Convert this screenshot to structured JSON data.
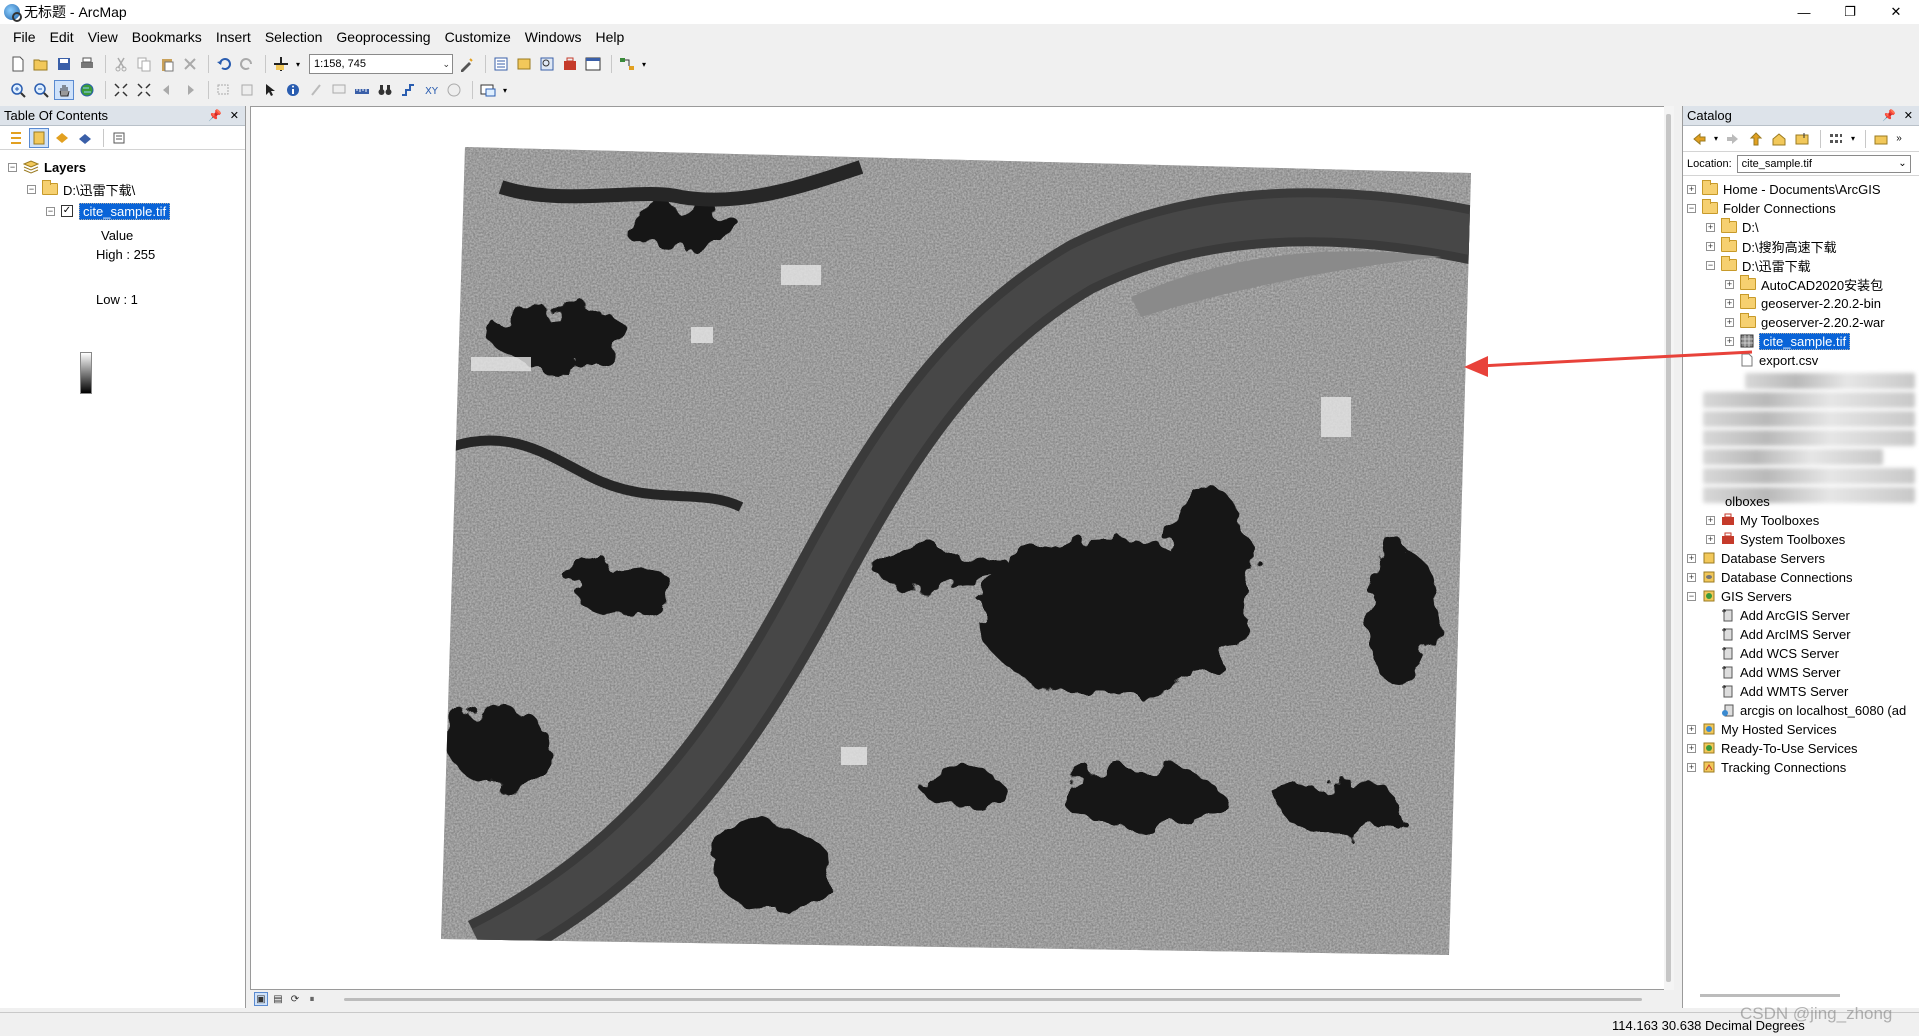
{
  "window": {
    "title": "无标题 - ArcMap",
    "minimize": "—",
    "maximize": "❐",
    "close": "✕"
  },
  "menu": [
    "File",
    "Edit",
    "View",
    "Bookmarks",
    "Insert",
    "Selection",
    "Geoprocessing",
    "Customize",
    "Windows",
    "Help"
  ],
  "toolbar": {
    "scale_value": "1:158, 745"
  },
  "toc": {
    "title": "Table Of Contents",
    "layers_label": "Layers",
    "folder_label": "D:\\迅雷下载\\",
    "layer_label": "cite_sample.tif",
    "legend_field": "Value",
    "legend_high": "High : 255",
    "legend_low": "Low : 1"
  },
  "catalog": {
    "title": "Catalog",
    "location_label": "Location:",
    "location_value": "cite_sample.tif",
    "items": {
      "home": "Home - Documents\\ArcGIS",
      "folder_connections": "Folder Connections",
      "d_drive": "D:\\",
      "sogou": "D:\\搜狗高速下载",
      "xunlei": "D:\\迅雷下载",
      "autocad": "AutoCAD2020安装包",
      "geoserver_bin": "geoserver-2.20.2-bin",
      "geoserver_war": "geoserver-2.20.2-war",
      "cite_sample": "cite_sample.tif",
      "export_csv": "export.csv",
      "toolboxes": "olboxes",
      "my_toolboxes": "My Toolboxes",
      "system_toolboxes": "System Toolboxes",
      "database_servers": "Database Servers",
      "database_connections": "Database Connections",
      "gis_servers": "GIS Servers",
      "add_arcgis": "Add ArcGIS Server",
      "add_arcims": "Add ArcIMS Server",
      "add_wcs": "Add WCS Server",
      "add_wms": "Add WMS Server",
      "add_wmts": "Add WMTS Server",
      "arcgis_localhost": "arcgis on localhost_6080 (ad",
      "my_hosted": "My Hosted Services",
      "ready_to_use": "Ready-To-Use Services",
      "tracking": "Tracking Connections"
    }
  },
  "status": {
    "coords": "114.163  30.638 Decimal Degrees",
    "watermark": "CSDN @jing_zhong"
  },
  "colors": {
    "selection": "#0a64d8",
    "arrow": "#e8423a",
    "panel_header": "#dde3ea"
  }
}
